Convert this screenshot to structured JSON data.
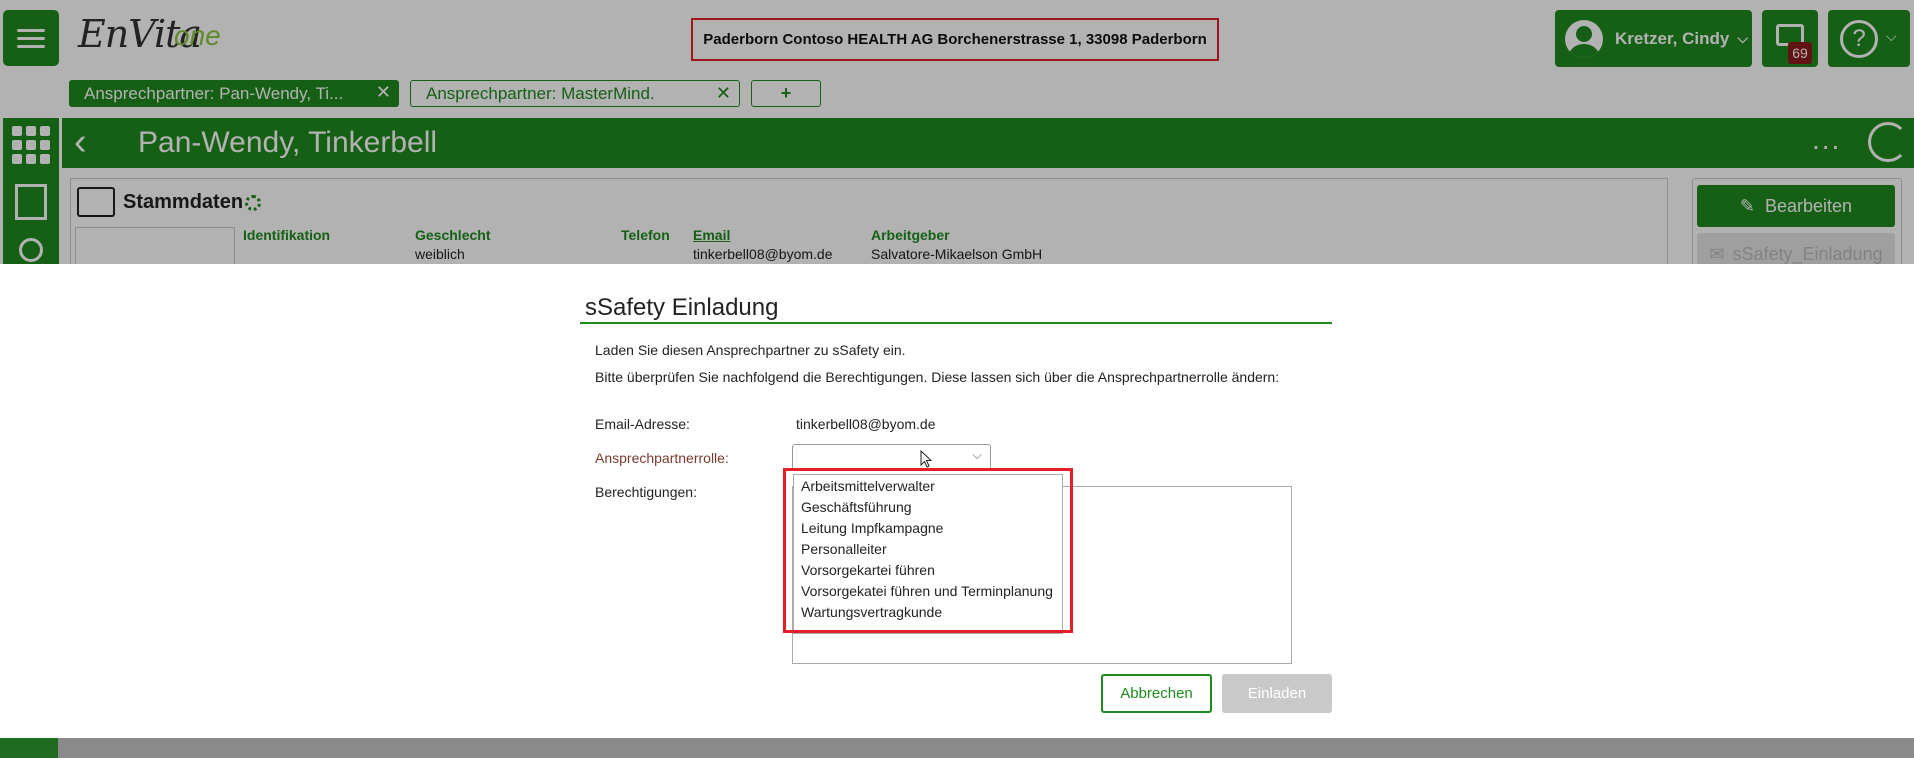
{
  "header": {
    "logo_main": "EnVita",
    "logo_sub": "one",
    "location": "Paderborn Contoso HEALTH AG Borchenerstrasse 1, 33098 Paderborn",
    "user_name": "Kretzer, Cindy",
    "message_count": "69",
    "help_symbol": "?",
    "chevron": "⌵"
  },
  "tabs": [
    {
      "label": "Ansprechpartner: Pan-Wendy, Ti...",
      "close": "✕",
      "active": true
    },
    {
      "label": "Ansprechpartner: MasterMind.",
      "close": "✕",
      "active": false
    }
  ],
  "tab_add_label": "+",
  "titlebar": {
    "back": "‹",
    "name": "Pan-Wendy, Tinkerbell",
    "more": "..."
  },
  "stammdaten": {
    "title": "Stammdaten",
    "fields": {
      "identifikation_label": "Identifikation",
      "geschlecht_label": "Geschlecht",
      "geschlecht_value": "weiblich",
      "telefon_label": "Telefon",
      "email_label": "Email",
      "email_value": "tinkerbell08@byom.de",
      "arbeitgeber_label": "Arbeitgeber",
      "arbeitgeber_value": "Salvatore-Mikaelson GmbH"
    }
  },
  "actions": {
    "edit_label": "Bearbeiten",
    "ssafety_label": "sSafety_Einladung"
  },
  "modal": {
    "title": "sSafety Einladung",
    "intro1": "Laden Sie diesen Ansprechpartner zu sSafety ein.",
    "intro2": "Bitte überprüfen Sie nachfolgend die Berechtigungen. Diese lassen sich über die Ansprechpartnerrolle ändern:",
    "email_label": "Email-Adresse:",
    "email_value": "tinkerbell08@byom.de",
    "role_label": "Ansprechpartnerrolle:",
    "role_value": "",
    "permissions_label": "Berechtigungen:",
    "role_options": [
      "Arbeitsmittelverwalter",
      "Geschäftsführung",
      "Leitung Impfkampagne",
      "Personalleiter",
      "Vorsorgekartei führen",
      "Vorsorgekatei führen und Terminplanung",
      "Wartungsvertragkunde"
    ],
    "cancel_label": "Abbrechen",
    "invite_label": "Einladen"
  },
  "colors": {
    "brand_green": "#1f8a1f",
    "highlight_red": "#e3202a",
    "badge_red": "#8b1a1a",
    "disabled_gray": "#c9c9c9"
  },
  "icons": [
    "hamburger-icon",
    "user-avatar-icon",
    "chat-icon",
    "help-icon",
    "grid-icon",
    "building-icon",
    "person-icon",
    "back-icon",
    "refresh-icon",
    "contact-card-icon",
    "gear-icon",
    "pencil-icon",
    "mail-icon",
    "chevron-down-icon",
    "mouse-cursor-icon"
  ]
}
